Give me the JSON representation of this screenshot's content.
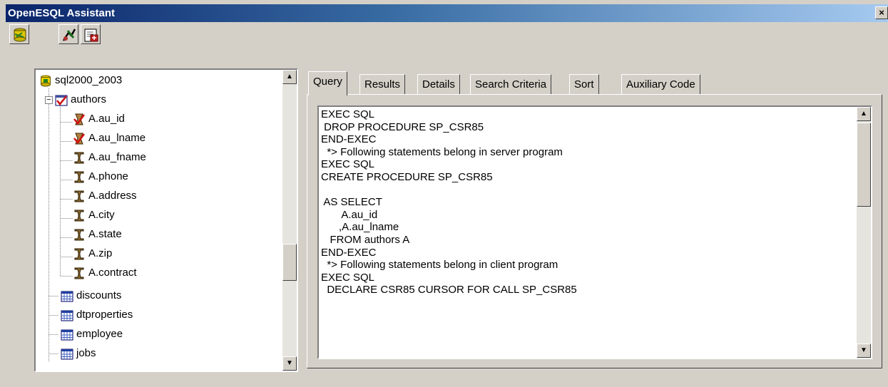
{
  "window": {
    "title": "OpenESQL Assistant",
    "close_label": "×"
  },
  "toolbar": {
    "buttons": [
      {
        "icon": "connect-database-icon"
      },
      {
        "icon": "generate-code-icon"
      },
      {
        "icon": "insert-code-icon"
      }
    ]
  },
  "tree": {
    "root": {
      "label": "sql2000_2003",
      "icon": "database-icon"
    },
    "expander": "−",
    "tables": [
      {
        "label": "authors",
        "icon": "checked-table-icon",
        "expanded": true
      },
      {
        "label": "discounts",
        "icon": "table-icon"
      },
      {
        "label": "dtproperties",
        "icon": "table-icon"
      },
      {
        "label": "employee",
        "icon": "table-icon"
      },
      {
        "label": "jobs",
        "icon": "table-icon"
      }
    ],
    "columns": [
      {
        "label": "A.au_id",
        "selected": true
      },
      {
        "label": "A.au_lname",
        "selected": true
      },
      {
        "label": "A.au_fname",
        "selected": false
      },
      {
        "label": "A.phone",
        "selected": false
      },
      {
        "label": "A.address",
        "selected": false
      },
      {
        "label": "A.city",
        "selected": false
      },
      {
        "label": "A.state",
        "selected": false
      },
      {
        "label": "A.zip",
        "selected": false
      },
      {
        "label": "A.contract",
        "selected": false
      }
    ],
    "scroll_up": "▲",
    "scroll_down": "▼"
  },
  "tabs": [
    {
      "label": "Query",
      "active": true
    },
    {
      "label": "Results",
      "active": false
    },
    {
      "label": "Details",
      "active": false
    },
    {
      "label": "Search Criteria",
      "active": false
    },
    {
      "label": "Sort",
      "active": false
    },
    {
      "label": "Auxiliary Code",
      "active": false
    }
  ],
  "query": {
    "lines": [
      "EXEC SQL",
      " DROP PROCEDURE SP_CSR85",
      "END-EXEC",
      "  *> Following statements belong in server program",
      "EXEC SQL",
      "CREATE PROCEDURE SP_CSR85",
      "",
      " AS SELECT",
      "       A.au_id",
      "      ,A.au_lname",
      "   FROM authors A",
      "END-EXEC",
      "  *> Following statements belong in client program",
      "EXEC SQL",
      "  DECLARE CSR85 CURSOR FOR CALL SP_CSR85"
    ],
    "scroll_up": "▲",
    "scroll_down": "▼"
  },
  "colors": {
    "title_start": "#0a246a",
    "title_end": "#a6caf0",
    "face": "#d4d0c8"
  }
}
